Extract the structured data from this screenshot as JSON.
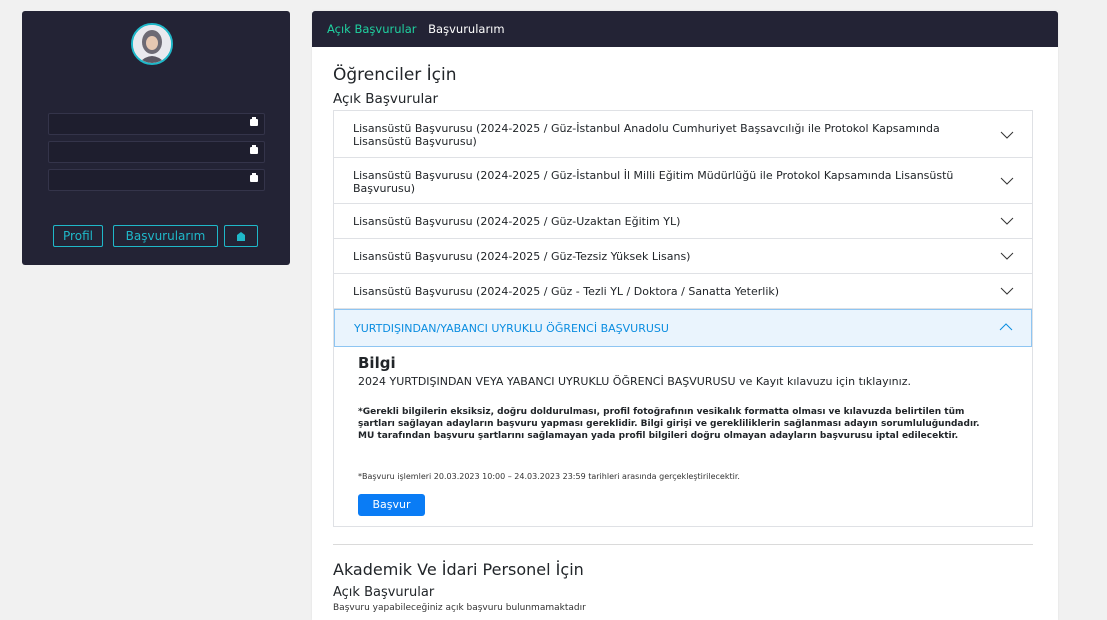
{
  "topnav": {
    "open_applications": "Açık Başvurular",
    "my_applications": "Başvurularım"
  },
  "sidebar": {
    "buttons": {
      "profile": "Profil",
      "applications": "Başvurularım",
      "logout_icon": "door-icon"
    }
  },
  "students": {
    "title": "Öğrenciler İçin",
    "subtitle": "Açık Başvurular",
    "items": [
      {
        "label": "Lisansüstü Başvurusu (2024-2025 / Güz-İstanbul Anadolu Cumhuriyet Başsavcılığı ile Protokol Kapsamında Lisansüstü Başvurusu)"
      },
      {
        "label": "Lisansüstü Başvurusu (2024-2025 / Güz-İstanbul İl Milli Eğitim Müdürlüğü ile Protokol Kapsamında Lisansüstü Başvurusu)"
      },
      {
        "label": "Lisansüstü Başvurusu (2024-2025 / Güz-Uzaktan Eğitim YL)"
      },
      {
        "label": "Lisansüstü Başvurusu (2024-2025 / Güz-Tezsiz Yüksek Lisans)"
      },
      {
        "label": "Lisansüstü Başvurusu (2024-2025 / Güz - Tezli YL / Doktora / Sanatta Yeterlik)"
      },
      {
        "label": "YURTDIŞINDAN/YABANCI UYRUKLU ÖĞRENCİ BAŞVURUSU"
      }
    ],
    "expanded": {
      "heading": "Bilgi",
      "intro": "2024 YURTDIŞINDAN VEYA YABANCI UYRUKLU ÖĞRENCİ BAŞVURUSU ve Kayıt kılavuzu için tıklayınız.",
      "note": "*Gerekli bilgilerin eksiksiz, doğru doldurulması, profil fotoğrafının vesikalık formatta olması ve kılavuzda belirtilen tüm şartları sağlayan adayların başvuru yapması gereklidir. Bilgi girişi ve gerekliliklerin sağlanması adayın sorumluluğundadır. MU tarafından başvuru şartlarını sağlamayan yada profil bilgileri doğru olmayan adayların başvurusu iptal edilecektir.",
      "dates": "*Başvuru işlemleri 20.03.2023 10:00 – 24.03.2023 23:59 tarihleri arasında gerçekleştirilecektir.",
      "apply_button": "Başvur"
    }
  },
  "staff": {
    "title": "Akademik Ve İdari Personel İçin",
    "subtitle": "Açık Başvurular",
    "empty_text": "Başvuru yapabileceğiniz açık başvuru bulunmamaktadır"
  },
  "colors": {
    "accent": "#1fb8c9",
    "nav_bg": "#232335",
    "active_tab": "#1fd1a0",
    "primary": "#0a7cf5"
  }
}
